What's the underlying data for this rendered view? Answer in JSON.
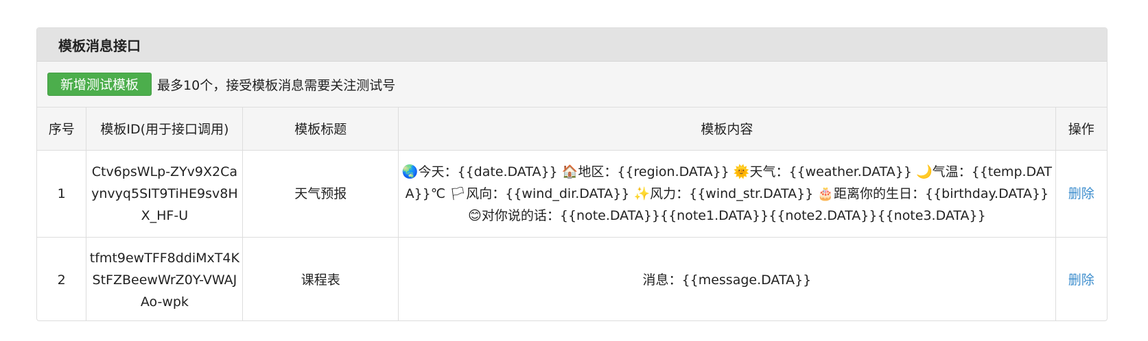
{
  "panel": {
    "title": "模板消息接口"
  },
  "toolbar": {
    "add_button_label": "新增测试模板",
    "note": "最多10个，接受模板消息需要关注测试号"
  },
  "table": {
    "headers": {
      "index": "序号",
      "template_id": "模板ID(用于接口调用)",
      "title": "模板标题",
      "content": "模板内容",
      "action": "操作"
    },
    "rows": [
      {
        "index": "1",
        "template_id": "Ctv6psWLp-ZYv9X2Caynvyq5SIT9TiHE9sv8HX_HF-U",
        "title": "天气预报",
        "content": "🌏今天：{{date.DATA}} 🏠地区：{{region.DATA}} 🌞天气：{{weather.DATA}} 🌙气温：{{temp.DATA}}℃ 🏳风向：{{wind_dir.DATA}} ✨风力：{{wind_str.DATA}} 🎂距离你的生日：{{birthday.DATA}} 😊对你说的话：{{note.DATA}}{{note1.DATA}}{{note2.DATA}}{{note3.DATA}}",
        "action": "删除"
      },
      {
        "index": "2",
        "template_id": "tfmt9ewTFF8ddiMxT4KStFZBeewWrZ0Y-VWAJAo-wpk",
        "title": "课程表",
        "content": "消息：{{message.DATA}}",
        "action": "删除"
      }
    ]
  },
  "colors": {
    "add_button": "#4cae4c",
    "link": "#3c8dcd",
    "heading_bg": "#e3e3e3"
  }
}
